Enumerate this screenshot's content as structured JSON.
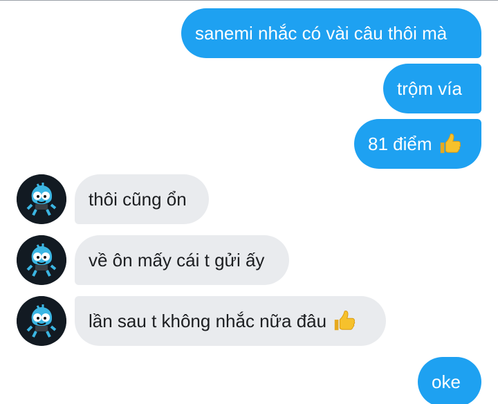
{
  "conversation": {
    "outgoing": [
      {
        "text": "sanemi nhắc có vài câu thôi mà"
      },
      {
        "text": "trộm vía"
      },
      {
        "text": "81 điểm",
        "emoji": "thumbs-up-icon"
      },
      {
        "text": "oke"
      }
    ],
    "incoming": [
      {
        "text": "thôi cũng ổn"
      },
      {
        "text": "về ôn mấy cái t gửi ấy"
      },
      {
        "text": "lần sau t không nhắc nữa đâu",
        "emoji": "thumbs-up-icon"
      }
    ]
  },
  "colors": {
    "outgoing_bubble": "#1ea1f1",
    "incoming_bubble": "#e9ebee",
    "outgoing_text": "#ffffff",
    "incoming_text": "#1c1e21",
    "thumb": "#f6c12c"
  }
}
